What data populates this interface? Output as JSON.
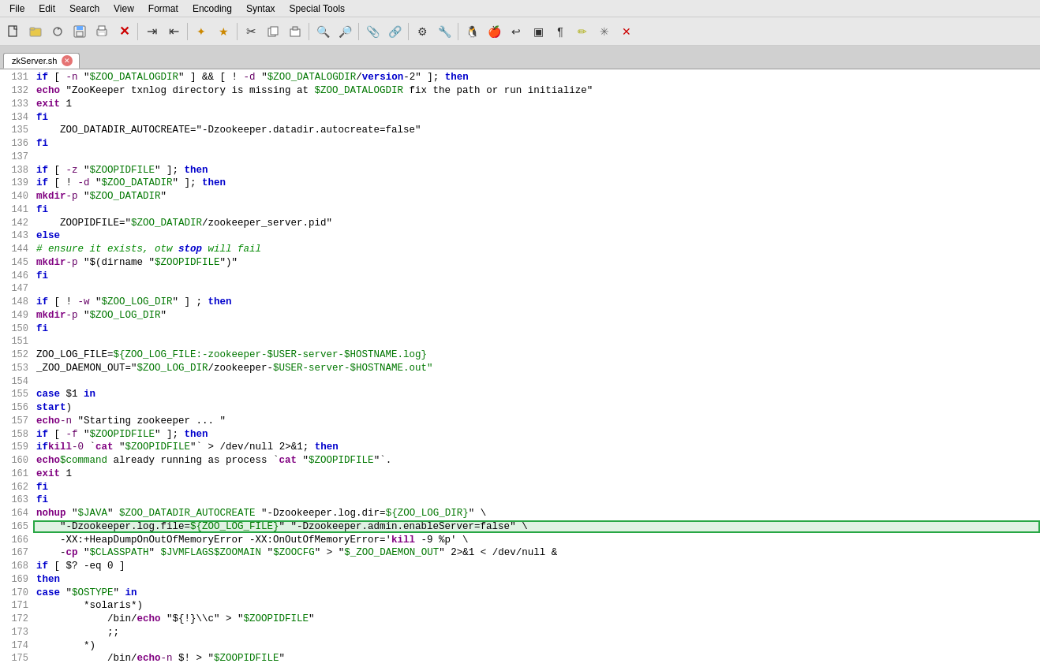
{
  "menu": {
    "items": [
      "File",
      "Edit",
      "Search",
      "View",
      "Format",
      "Encoding",
      "Syntax",
      "Special Tools"
    ]
  },
  "toolbar": {
    "buttons": [
      {
        "name": "new-button",
        "icon": "📄"
      },
      {
        "name": "open-button",
        "icon": "📁"
      },
      {
        "name": "reload-button",
        "icon": "🔄"
      },
      {
        "name": "save-button",
        "icon": "💾"
      },
      {
        "name": "print-button",
        "icon": "🖨️"
      },
      {
        "name": "close-button",
        "icon": "✕"
      },
      {
        "name": "indent-button",
        "icon": "⇥"
      },
      {
        "name": "unindent-button",
        "icon": "⇤"
      },
      {
        "name": "bookmark-button",
        "icon": "⭐"
      },
      {
        "name": "bookmark2-button",
        "icon": "★"
      },
      {
        "name": "cut-button",
        "icon": "✂"
      },
      {
        "name": "copy-button",
        "icon": "📋"
      },
      {
        "name": "paste-button",
        "icon": "📌"
      },
      {
        "name": "find-button",
        "icon": "🔍"
      },
      {
        "name": "find-next-button",
        "icon": "🔎"
      },
      {
        "name": "clip-button",
        "icon": "📎"
      },
      {
        "name": "clip2-button",
        "icon": "🔗"
      },
      {
        "name": "macro-button",
        "icon": "⚙"
      },
      {
        "name": "macro2-button",
        "icon": "🔧"
      },
      {
        "name": "linux-button",
        "icon": "🐧"
      },
      {
        "name": "apple-button",
        "icon": "🍎"
      },
      {
        "name": "undo-button",
        "icon": "↩"
      },
      {
        "name": "toggle-button",
        "icon": "▣"
      },
      {
        "name": "pilcrow-button",
        "icon": "¶"
      },
      {
        "name": "highlight-button",
        "icon": "✏"
      },
      {
        "name": "extra-button",
        "icon": "✳"
      },
      {
        "name": "close2-button",
        "icon": "✕"
      }
    ]
  },
  "tab": {
    "label": "zkServer.sh"
  },
  "lines": [
    {
      "num": 131,
      "code": "    if [ -n \"$ZOO_DATALOGDIR\" ] && [ ! -d \"$ZOO_DATALOGDIR/version-2\" ]; then"
    },
    {
      "num": 132,
      "code": "        echo \"ZooKeeper txnlog directory is missing at $ZOO_DATALOGDIR fix the path or run initialize\""
    },
    {
      "num": 133,
      "code": "        exit 1"
    },
    {
      "num": 134,
      "code": "    fi"
    },
    {
      "num": 135,
      "code": "    ZOO_DATADIR_AUTOCREATE=\"-Dzookeeper.datadir.autocreate=false\""
    },
    {
      "num": 136,
      "code": "fi"
    },
    {
      "num": 137,
      "code": ""
    },
    {
      "num": 138,
      "code": "if [ -z \"$ZOOPIDFILE\" ]; then"
    },
    {
      "num": 139,
      "code": "    if [ ! -d \"$ZOO_DATADIR\" ]; then"
    },
    {
      "num": 140,
      "code": "        mkdir -p \"$ZOO_DATADIR\""
    },
    {
      "num": 141,
      "code": "    fi"
    },
    {
      "num": 142,
      "code": "    ZOOPIDFILE=\"$ZOO_DATADIR/zookeeper_server.pid\""
    },
    {
      "num": 143,
      "code": "else"
    },
    {
      "num": 144,
      "code": "    # ensure it exists, otw stop will fail"
    },
    {
      "num": 145,
      "code": "    mkdir -p \"$(dirname \"$ZOOPIDFILE\")\""
    },
    {
      "num": 146,
      "code": "fi"
    },
    {
      "num": 147,
      "code": ""
    },
    {
      "num": 148,
      "code": "if [ ! -w \"$ZOO_LOG_DIR\" ] ; then"
    },
    {
      "num": 149,
      "code": "mkdir -p \"$ZOO_LOG_DIR\""
    },
    {
      "num": 150,
      "code": "fi"
    },
    {
      "num": 151,
      "code": ""
    },
    {
      "num": 152,
      "code": "ZOO_LOG_FILE=${ZOO_LOG_FILE:-zookeeper-$USER-server-$HOSTNAME.log}"
    },
    {
      "num": 153,
      "code": "_ZOO_DAEMON_OUT=\"$ZOO_LOG_DIR/zookeeper-$USER-server-$HOSTNAME.out\""
    },
    {
      "num": 154,
      "code": ""
    },
    {
      "num": 155,
      "code": "case $1 in"
    },
    {
      "num": 156,
      "code": "start)"
    },
    {
      "num": 157,
      "code": "    echo  -n \"Starting zookeeper ... \""
    },
    {
      "num": 158,
      "code": "    if [ -f \"$ZOOPIDFILE\" ]; then"
    },
    {
      "num": 159,
      "code": "        if kill -0 `cat \"$ZOOPIDFILE\"` > /dev/null 2>&1; then"
    },
    {
      "num": 160,
      "code": "            echo $command already running as process `cat \"$ZOOPIDFILE\"`."
    },
    {
      "num": 161,
      "code": "            exit 1"
    },
    {
      "num": 162,
      "code": "        fi"
    },
    {
      "num": 163,
      "code": "    fi"
    },
    {
      "num": 164,
      "code": "    nohup \"$JAVA\" $ZOO_DATADIR_AUTOCREATE \"-Dzookeeper.log.dir=${ZOO_LOG_DIR}\" \\"
    },
    {
      "num": 165,
      "code": "    \"-Dzookeeper.log.file=${ZOO_LOG_FILE}\" \"-Dzookeeper.admin.enableServer=false\" \\",
      "selected": true
    },
    {
      "num": 166,
      "code": "    -XX:+HeapDumpOnOutOfMemoryError -XX:OnOutOfMemoryError='kill -9 %p' \\"
    },
    {
      "num": 167,
      "code": "    -cp \"$CLASSPATH\" $JVMFLAGS $ZOOMAIN \"$ZOOCFG\" > \"$_ZOO_DAEMON_OUT\" 2>&1 < /dev/null &"
    },
    {
      "num": 168,
      "code": "    if [ $? -eq 0 ]"
    },
    {
      "num": 169,
      "code": "    then"
    },
    {
      "num": 170,
      "code": "        case \"$OSTYPE\" in"
    },
    {
      "num": 171,
      "code": "        *solaris*)"
    },
    {
      "num": 172,
      "code": "            /bin/echo \"${!}\\\\c\" > \"$ZOOPIDFILE\""
    },
    {
      "num": 173,
      "code": "            ;;"
    },
    {
      "num": 174,
      "code": "        *)"
    },
    {
      "num": 175,
      "code": "            /bin/echo -n $! > \"$ZOOPIDFILE\""
    }
  ]
}
